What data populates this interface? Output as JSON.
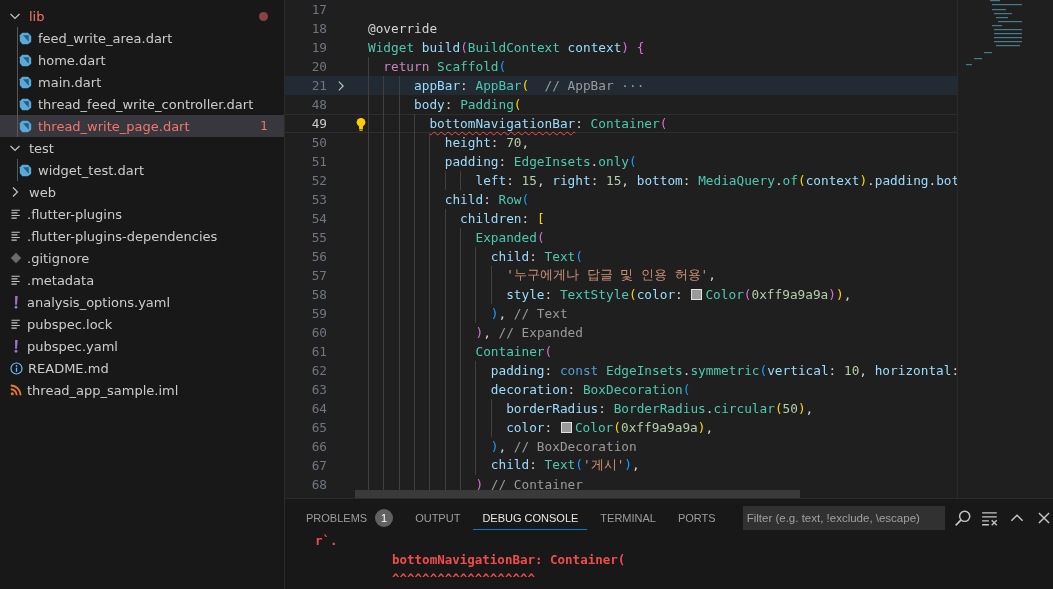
{
  "explorer": {
    "items": [
      {
        "name": "lib",
        "kind": "folder",
        "expanded": true,
        "error": true,
        "children": [
          {
            "name": "feed_write_area.dart",
            "kind": "dart",
            "selected": false,
            "error": false
          },
          {
            "name": "home.dart",
            "kind": "dart",
            "selected": false,
            "error": false
          },
          {
            "name": "main.dart",
            "kind": "dart",
            "selected": false,
            "error": false
          },
          {
            "name": "thread_feed_write_controller.dart",
            "kind": "dart",
            "selected": false,
            "error": false
          },
          {
            "name": "thread_write_page.dart",
            "kind": "dart",
            "selected": true,
            "error": true,
            "problems": "1"
          }
        ]
      },
      {
        "name": "test",
        "kind": "folder",
        "expanded": true,
        "error": false,
        "children": [
          {
            "name": "widget_test.dart",
            "kind": "dart",
            "selected": false,
            "error": false
          }
        ]
      },
      {
        "name": "web",
        "kind": "folder",
        "expanded": false,
        "error": false
      },
      {
        "name": ".flutter-plugins",
        "kind": "lines",
        "selected": false,
        "error": false
      },
      {
        "name": ".flutter-plugins-dependencies",
        "kind": "lines",
        "selected": false,
        "error": false
      },
      {
        "name": ".gitignore",
        "kind": "git",
        "selected": false,
        "error": false
      },
      {
        "name": ".metadata",
        "kind": "lines",
        "selected": false,
        "error": false
      },
      {
        "name": "analysis_options.yaml",
        "kind": "yaml",
        "selected": false,
        "error": false
      },
      {
        "name": "pubspec.lock",
        "kind": "lines",
        "selected": false,
        "error": false
      },
      {
        "name": "pubspec.yaml",
        "kind": "yaml",
        "selected": false,
        "error": false
      },
      {
        "name": "README.md",
        "kind": "info",
        "selected": false,
        "error": false
      },
      {
        "name": "thread_app_sample.iml",
        "kind": "rss",
        "selected": false,
        "error": false
      }
    ]
  },
  "editor": {
    "lines": [
      {
        "number": "17"
      },
      {
        "number": "18",
        "tokens": [
          {
            "kind": "annot",
            "text": "@override"
          }
        ]
      },
      {
        "number": "19",
        "tokens": [
          {
            "kind": "type",
            "text": "Widget "
          },
          {
            "kind": "prop",
            "text": "build"
          },
          {
            "kind": "b2",
            "text": "("
          },
          {
            "kind": "type",
            "text": "BuildContext "
          },
          {
            "kind": "prop",
            "text": "context"
          },
          {
            "kind": "b2",
            "text": ") "
          },
          {
            "kind": "b2",
            "text": "{"
          }
        ]
      },
      {
        "number": "20",
        "tokens": [
          {
            "kind": "kw",
            "text": "  return "
          },
          {
            "kind": "type",
            "text": "Scaffold"
          },
          {
            "kind": "b3",
            "text": "("
          }
        ]
      },
      {
        "number": "21",
        "folded": true,
        "tokens": [
          {
            "kind": "prop",
            "text": "      appBar"
          },
          {
            "kind": "plain",
            "text": ": "
          },
          {
            "kind": "type",
            "text": "AppBar"
          },
          {
            "kind": "b1",
            "text": "(  "
          },
          {
            "kind": "comment",
            "text": "// AppBar ···"
          }
        ]
      },
      {
        "number": "48",
        "tokens": [
          {
            "kind": "prop",
            "text": "      body"
          },
          {
            "kind": "plain",
            "text": ": "
          },
          {
            "kind": "type",
            "text": "Padding"
          },
          {
            "kind": "b1",
            "text": "("
          }
        ]
      },
      {
        "number": "49",
        "current": true,
        "lightbulb": true,
        "tokens": [
          {
            "kind": "prop",
            "text": "        bottomNavigationBar",
            "error": true
          },
          {
            "kind": "plain",
            "text": ": "
          },
          {
            "kind": "type",
            "text": "Container"
          },
          {
            "kind": "b2",
            "text": "("
          }
        ]
      },
      {
        "number": "50",
        "tokens": [
          {
            "kind": "prop",
            "text": "          height"
          },
          {
            "kind": "plain",
            "text": ": "
          },
          {
            "kind": "num",
            "text": "70"
          },
          {
            "kind": "plain",
            "text": ","
          }
        ]
      },
      {
        "number": "51",
        "tokens": [
          {
            "kind": "prop",
            "text": "          padding"
          },
          {
            "kind": "plain",
            "text": ": "
          },
          {
            "kind": "type",
            "text": "EdgeInsets"
          },
          {
            "kind": "plain",
            "text": "."
          },
          {
            "kind": "type",
            "text": "only"
          },
          {
            "kind": "b3",
            "text": "("
          }
        ]
      },
      {
        "number": "52",
        "tokens": [
          {
            "kind": "prop",
            "text": "              left"
          },
          {
            "kind": "plain",
            "text": ": "
          },
          {
            "kind": "num",
            "text": "15"
          },
          {
            "kind": "plain",
            "text": ", "
          },
          {
            "kind": "prop",
            "text": "right"
          },
          {
            "kind": "plain",
            "text": ": "
          },
          {
            "kind": "num",
            "text": "15"
          },
          {
            "kind": "plain",
            "text": ", "
          },
          {
            "kind": "prop",
            "text": "bottom"
          },
          {
            "kind": "plain",
            "text": ": "
          },
          {
            "kind": "type",
            "text": "MediaQuery"
          },
          {
            "kind": "plain",
            "text": "."
          },
          {
            "kind": "type",
            "text": "of"
          },
          {
            "kind": "b1",
            "text": "("
          },
          {
            "kind": "prop",
            "text": "context"
          },
          {
            "kind": "b1",
            "text": ")"
          },
          {
            "kind": "plain",
            "text": "."
          },
          {
            "kind": "prop",
            "text": "padding"
          },
          {
            "kind": "plain",
            "text": "."
          },
          {
            "kind": "prop",
            "text": "bot"
          }
        ]
      },
      {
        "number": "53",
        "tokens": [
          {
            "kind": "prop",
            "text": "          child"
          },
          {
            "kind": "plain",
            "text": ": "
          },
          {
            "kind": "type",
            "text": "Row"
          },
          {
            "kind": "b3",
            "text": "("
          }
        ]
      },
      {
        "number": "54",
        "tokens": [
          {
            "kind": "prop",
            "text": "            children"
          },
          {
            "kind": "plain",
            "text": ": "
          },
          {
            "kind": "b1",
            "text": "["
          }
        ]
      },
      {
        "number": "55",
        "tokens": [
          {
            "kind": "type",
            "text": "              Expanded"
          },
          {
            "kind": "b2",
            "text": "("
          }
        ]
      },
      {
        "number": "56",
        "tokens": [
          {
            "kind": "prop",
            "text": "                child"
          },
          {
            "kind": "plain",
            "text": ": "
          },
          {
            "kind": "type",
            "text": "Text"
          },
          {
            "kind": "b3",
            "text": "("
          }
        ]
      },
      {
        "number": "57",
        "tokens": [
          {
            "kind": "str",
            "text": "                  '누구에게나 답글 및 인용 허용'"
          },
          {
            "kind": "plain",
            "text": ","
          }
        ]
      },
      {
        "number": "58",
        "tokens": [
          {
            "kind": "prop",
            "text": "                  style"
          },
          {
            "kind": "plain",
            "text": ": "
          },
          {
            "kind": "type",
            "text": "TextStyle"
          },
          {
            "kind": "b1",
            "text": "("
          },
          {
            "kind": "prop",
            "text": "color"
          },
          {
            "kind": "plain",
            "text": ": "
          },
          {
            "kind": "swatch",
            "color": "#9a9a9a"
          },
          {
            "kind": "type",
            "text": "Color"
          },
          {
            "kind": "b2",
            "text": "("
          },
          {
            "kind": "num",
            "text": "0xff9a9a9a"
          },
          {
            "kind": "b2",
            "text": ")"
          },
          {
            "kind": "b1",
            "text": ")"
          },
          {
            "kind": "plain",
            "text": ","
          }
        ]
      },
      {
        "number": "59",
        "tokens": [
          {
            "kind": "b3",
            "text": "                )"
          },
          {
            "kind": "plain",
            "text": ", "
          },
          {
            "kind": "comment",
            "text": "// Text"
          }
        ]
      },
      {
        "number": "60",
        "tokens": [
          {
            "kind": "b2",
            "text": "              )"
          },
          {
            "kind": "plain",
            "text": ", "
          },
          {
            "kind": "comment",
            "text": "// Expanded"
          }
        ]
      },
      {
        "number": "61",
        "tokens": [
          {
            "kind": "type",
            "text": "              Container"
          },
          {
            "kind": "b2",
            "text": "("
          }
        ]
      },
      {
        "number": "62",
        "tokens": [
          {
            "kind": "prop",
            "text": "                padding"
          },
          {
            "kind": "plain",
            "text": ": "
          },
          {
            "kind": "const",
            "text": "const "
          },
          {
            "kind": "type",
            "text": "EdgeInsets"
          },
          {
            "kind": "plain",
            "text": "."
          },
          {
            "kind": "type",
            "text": "symmetric"
          },
          {
            "kind": "b3",
            "text": "("
          },
          {
            "kind": "prop",
            "text": "vertical"
          },
          {
            "kind": "plain",
            "text": ": "
          },
          {
            "kind": "num",
            "text": "10"
          },
          {
            "kind": "plain",
            "text": ", "
          },
          {
            "kind": "prop",
            "text": "horizontal"
          },
          {
            "kind": "plain",
            "text": ":"
          }
        ]
      },
      {
        "number": "63",
        "tokens": [
          {
            "kind": "prop",
            "text": "                decoration"
          },
          {
            "kind": "plain",
            "text": ": "
          },
          {
            "kind": "type",
            "text": "BoxDecoration"
          },
          {
            "kind": "b3",
            "text": "("
          }
        ]
      },
      {
        "number": "64",
        "tokens": [
          {
            "kind": "prop",
            "text": "                  borderRadius"
          },
          {
            "kind": "plain",
            "text": ": "
          },
          {
            "kind": "type",
            "text": "BorderRadius"
          },
          {
            "kind": "plain",
            "text": "."
          },
          {
            "kind": "type",
            "text": "circular"
          },
          {
            "kind": "b1",
            "text": "("
          },
          {
            "kind": "num",
            "text": "50"
          },
          {
            "kind": "b1",
            "text": ")"
          },
          {
            "kind": "plain",
            "text": ","
          }
        ]
      },
      {
        "number": "65",
        "tokens": [
          {
            "kind": "prop",
            "text": "                  color"
          },
          {
            "kind": "plain",
            "text": ": "
          },
          {
            "kind": "swatch",
            "color": "#9a9a9a"
          },
          {
            "kind": "type",
            "text": "Color"
          },
          {
            "kind": "b1",
            "text": "("
          },
          {
            "kind": "num",
            "text": "0xff9a9a9a"
          },
          {
            "kind": "b1",
            "text": ")"
          },
          {
            "kind": "plain",
            "text": ","
          }
        ]
      },
      {
        "number": "66",
        "tokens": [
          {
            "kind": "b3",
            "text": "                )"
          },
          {
            "kind": "plain",
            "text": ", "
          },
          {
            "kind": "comment",
            "text": "// BoxDecoration"
          }
        ]
      },
      {
        "number": "67",
        "tokens": [
          {
            "kind": "prop",
            "text": "                child"
          },
          {
            "kind": "plain",
            "text": ": "
          },
          {
            "kind": "type",
            "text": "Text"
          },
          {
            "kind": "b3",
            "text": "("
          },
          {
            "kind": "str",
            "text": "'게시'"
          },
          {
            "kind": "b3",
            "text": ")"
          },
          {
            "kind": "plain",
            "text": ","
          }
        ]
      },
      {
        "number": "68",
        "tokens": [
          {
            "kind": "b2",
            "text": "              ) "
          },
          {
            "kind": "comment",
            "text": "// Container"
          }
        ]
      }
    ]
  },
  "panel": {
    "tabs": [
      {
        "label": "PROBLEMS",
        "selected": false,
        "count": "1"
      },
      {
        "label": "OUTPUT",
        "selected": false
      },
      {
        "label": "DEBUG CONSOLE",
        "selected": true
      },
      {
        "label": "TERMINAL",
        "selected": false
      },
      {
        "label": "PORTS",
        "selected": false
      }
    ],
    "filter": {
      "placeholder": "Filter (e.g. text, !exclude, \\escape)"
    },
    "console": [
      {
        "kind": "fragment",
        "text": "r`."
      },
      {
        "kind": "source",
        "text": "bottomNavigationBar: Container("
      },
      {
        "kind": "source",
        "text": "^^^^^^^^^^^^^^^^^^^"
      }
    ]
  }
}
